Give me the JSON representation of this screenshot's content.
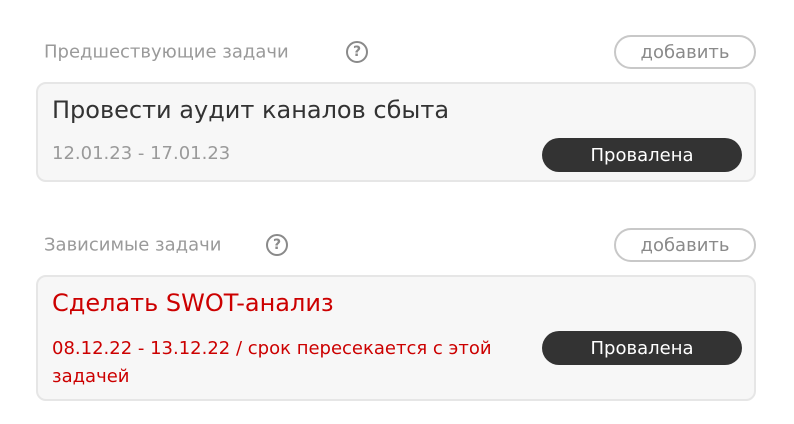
{
  "predecessors": {
    "title": "Предшествующие задачи",
    "help_icon": "question-circle-icon",
    "add_label": "добавить",
    "task": {
      "title": "Провести аудит каналов сбыта",
      "dates": "12.01.23 - 17.01.23",
      "status": "Провалена"
    }
  },
  "dependents": {
    "title": "Зависимые задачи",
    "help_icon": "question-circle-icon",
    "add_label": "добавить",
    "task": {
      "title": "Сделать  SWOT-анализ",
      "dates_warning": "08.12.22 - 13.12.22 / срок пересекается с этой задачей",
      "status": "Провалена"
    }
  },
  "colors": {
    "section_title": "#9a9a9a",
    "task_title_normal": "#333333",
    "task_meta_normal": "#9a9a9a",
    "conflict_red": "#cc0000",
    "status_pill_bg": "#333333",
    "status_pill_text": "#ffffff",
    "card_bg": "#f7f7f7",
    "card_border": "#e6e6e6"
  }
}
